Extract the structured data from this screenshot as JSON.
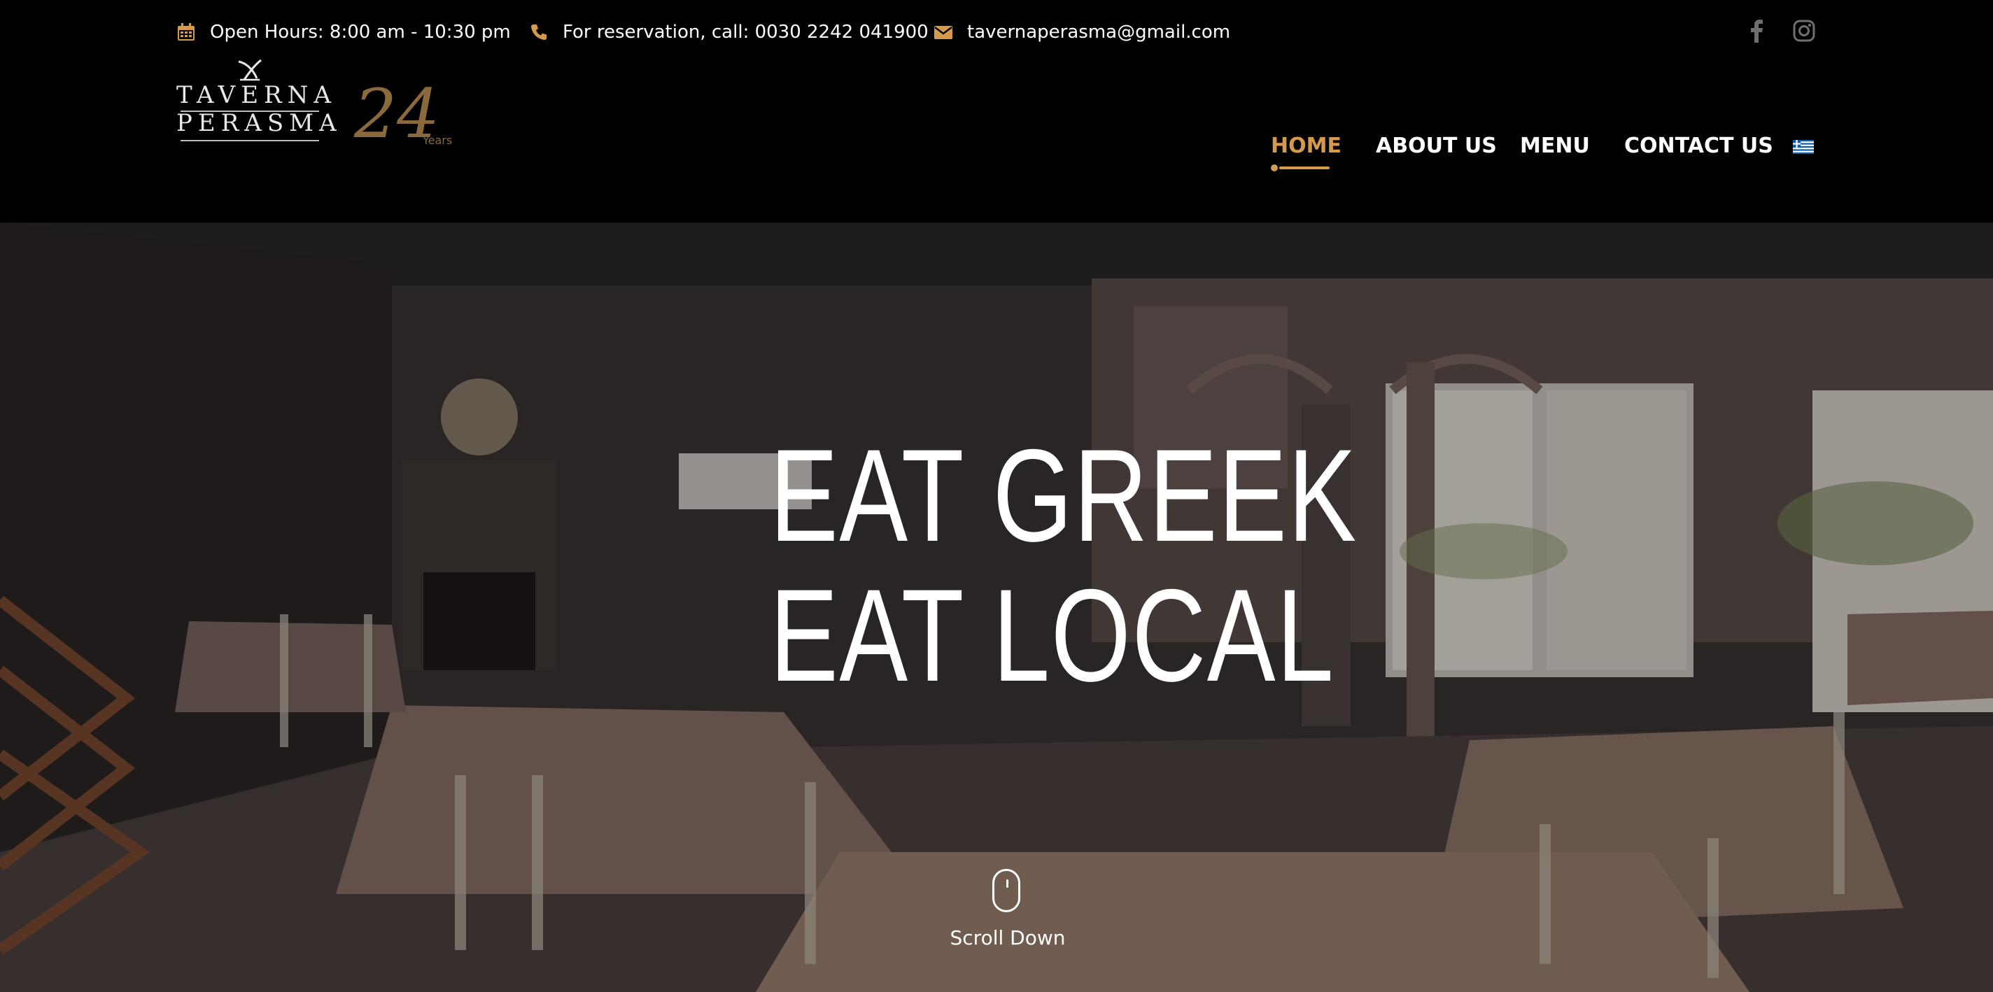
{
  "topbar": {
    "hours": "Open Hours: 8:00 am - 10:30 pm",
    "phone": "For reservation, call: 0030 2242 041900",
    "email": "tavernaperasma@gmail.com",
    "icons": {
      "hours": "calendar-icon",
      "phone": "phone-icon",
      "email": "envelope-icon"
    },
    "social": [
      "facebook-icon",
      "instagram-icon"
    ]
  },
  "logo": {
    "line1": "TAVERNA",
    "line2": "PERASMA",
    "badge_number": "24",
    "badge_text": "Years"
  },
  "nav": {
    "items": [
      {
        "label": "HOME",
        "active": true
      },
      {
        "label": "ABOUT US",
        "active": false
      },
      {
        "label": "MENU",
        "active": false
      },
      {
        "label": "CONTACT US",
        "active": false
      }
    ],
    "language_icon": "greek-flag-icon"
  },
  "hero": {
    "title_line1": "EAT GREEK",
    "title_line2": "EAT LOCAL",
    "scroll_label": "Scroll Down"
  },
  "colors": {
    "accent": "#d59a4a",
    "background": "#000000",
    "text": "#ffffff",
    "icon_muted": "#7a7a7a"
  }
}
